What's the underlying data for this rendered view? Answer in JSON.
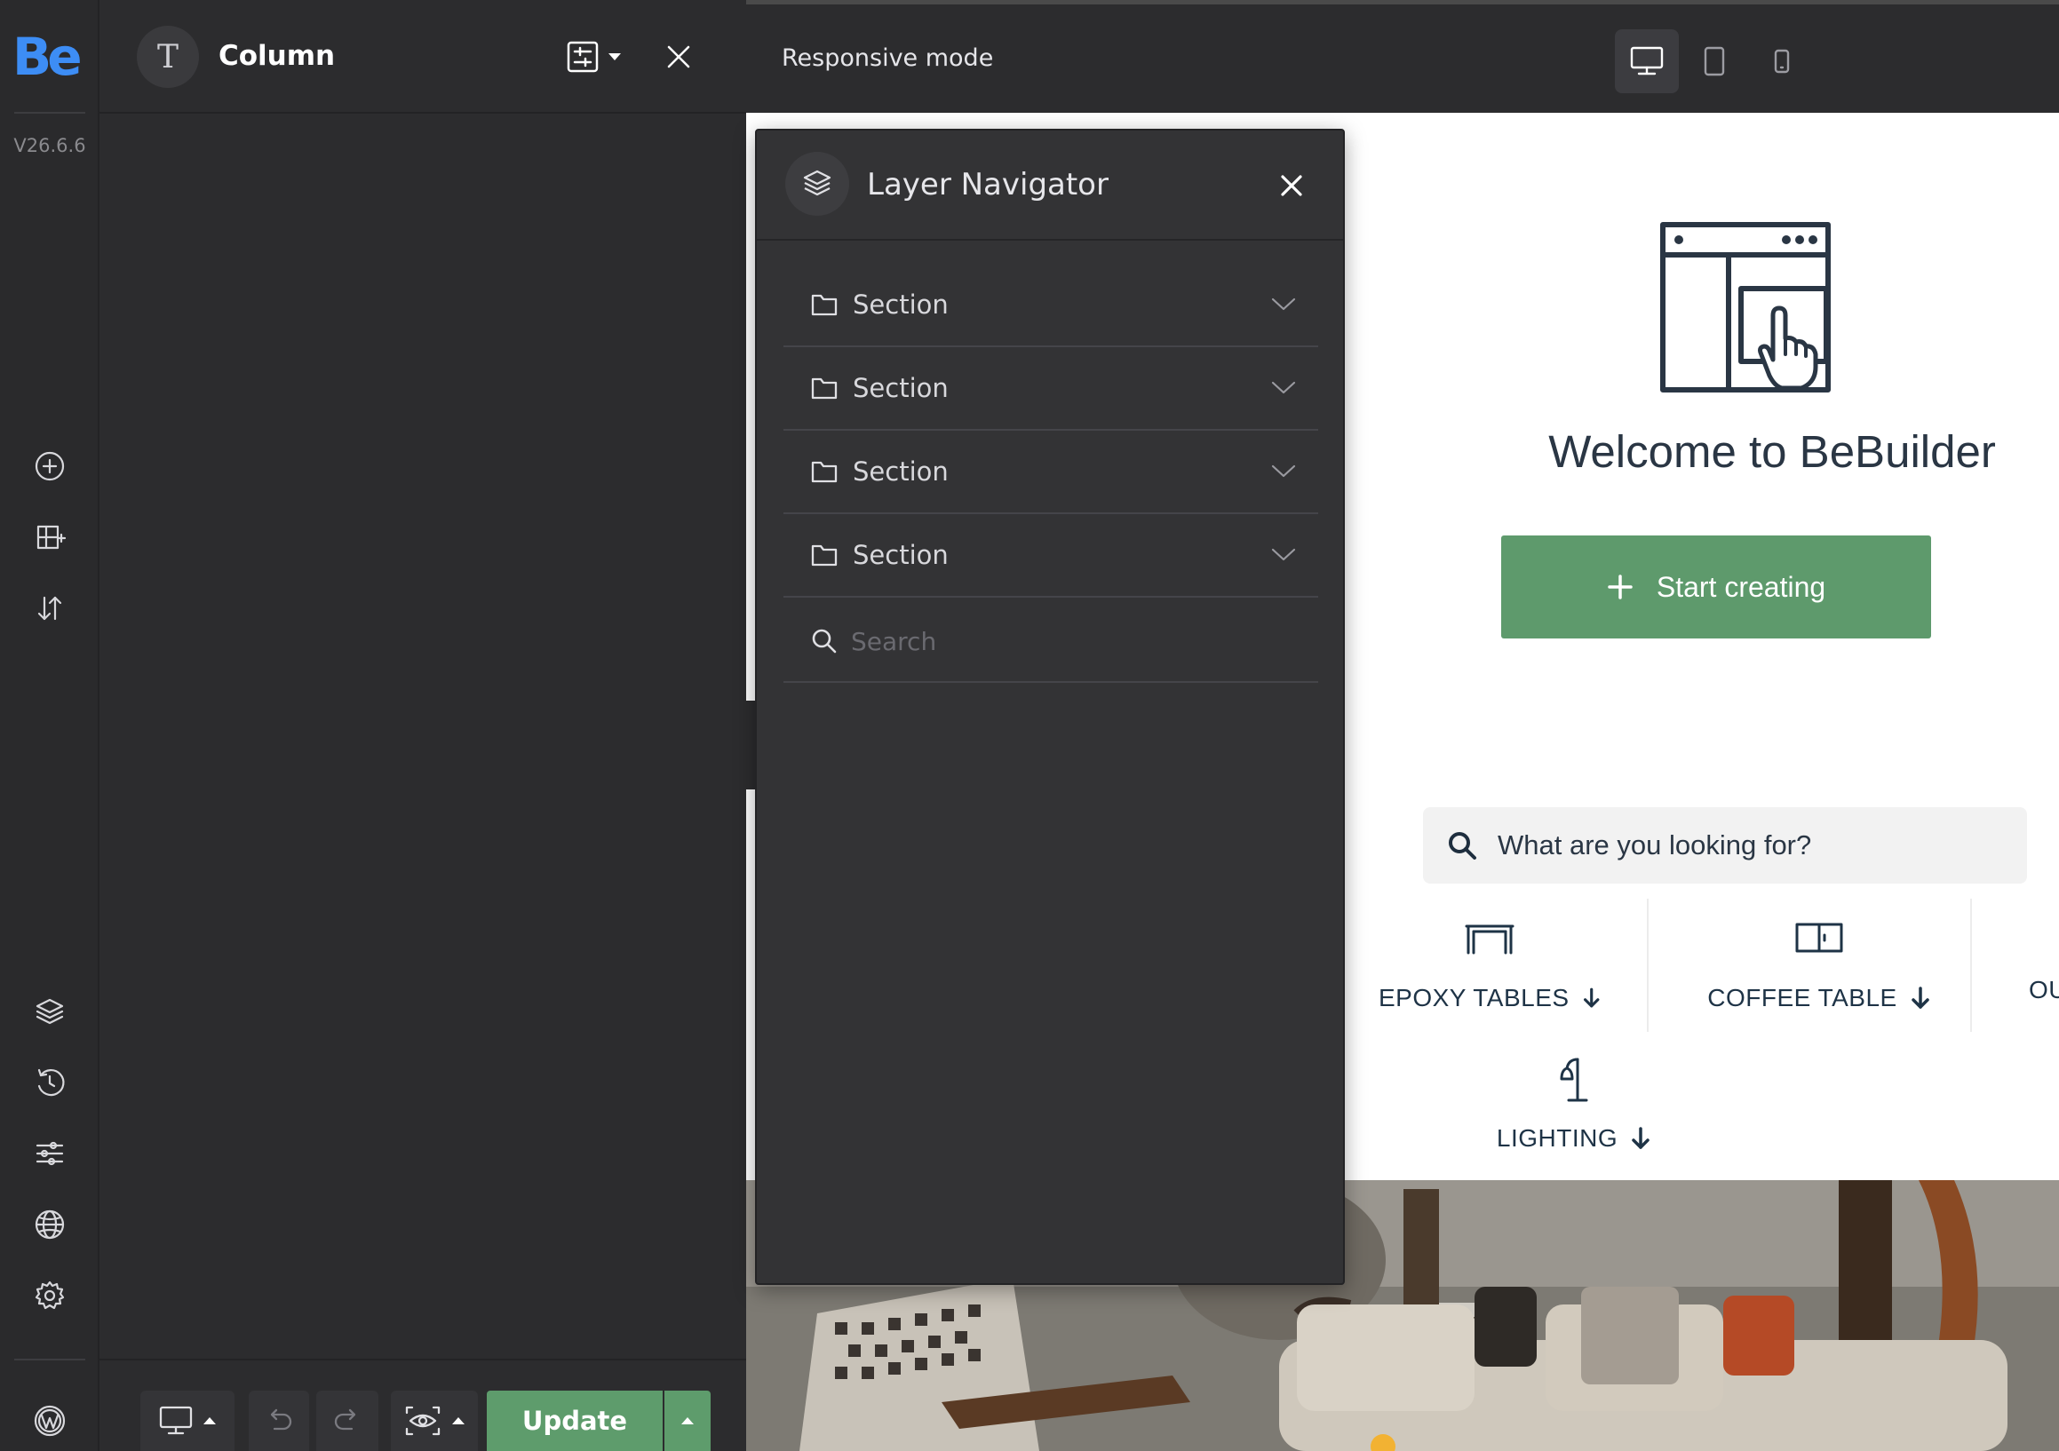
{
  "rail": {
    "logo": "Be",
    "version": "V26.6.6"
  },
  "panel": {
    "type_letter": "T",
    "title": "Column"
  },
  "topbar": {
    "responsive_label": "Responsive mode"
  },
  "toolbar": {
    "update_label": "Update"
  },
  "layer_navigator": {
    "title": "Layer Navigator",
    "items": [
      {
        "label": "Section"
      },
      {
        "label": "Section"
      },
      {
        "label": "Section"
      },
      {
        "label": "Section"
      }
    ],
    "search_placeholder": "Search"
  },
  "canvas": {
    "welcome": "Welcome to BeBuilder",
    "start_button": "Start creating",
    "search_placeholder": "What are you looking for?",
    "categories": [
      {
        "label": "EPOXY TABLES"
      },
      {
        "label": "COFFEE TABLE"
      },
      {
        "label": "OU"
      },
      {
        "label": "LIGHTING"
      }
    ]
  },
  "colors": {
    "brand": "#3d8df5",
    "accent_green": "#5e9c6c",
    "dark_bg": "#2c2c2e"
  }
}
